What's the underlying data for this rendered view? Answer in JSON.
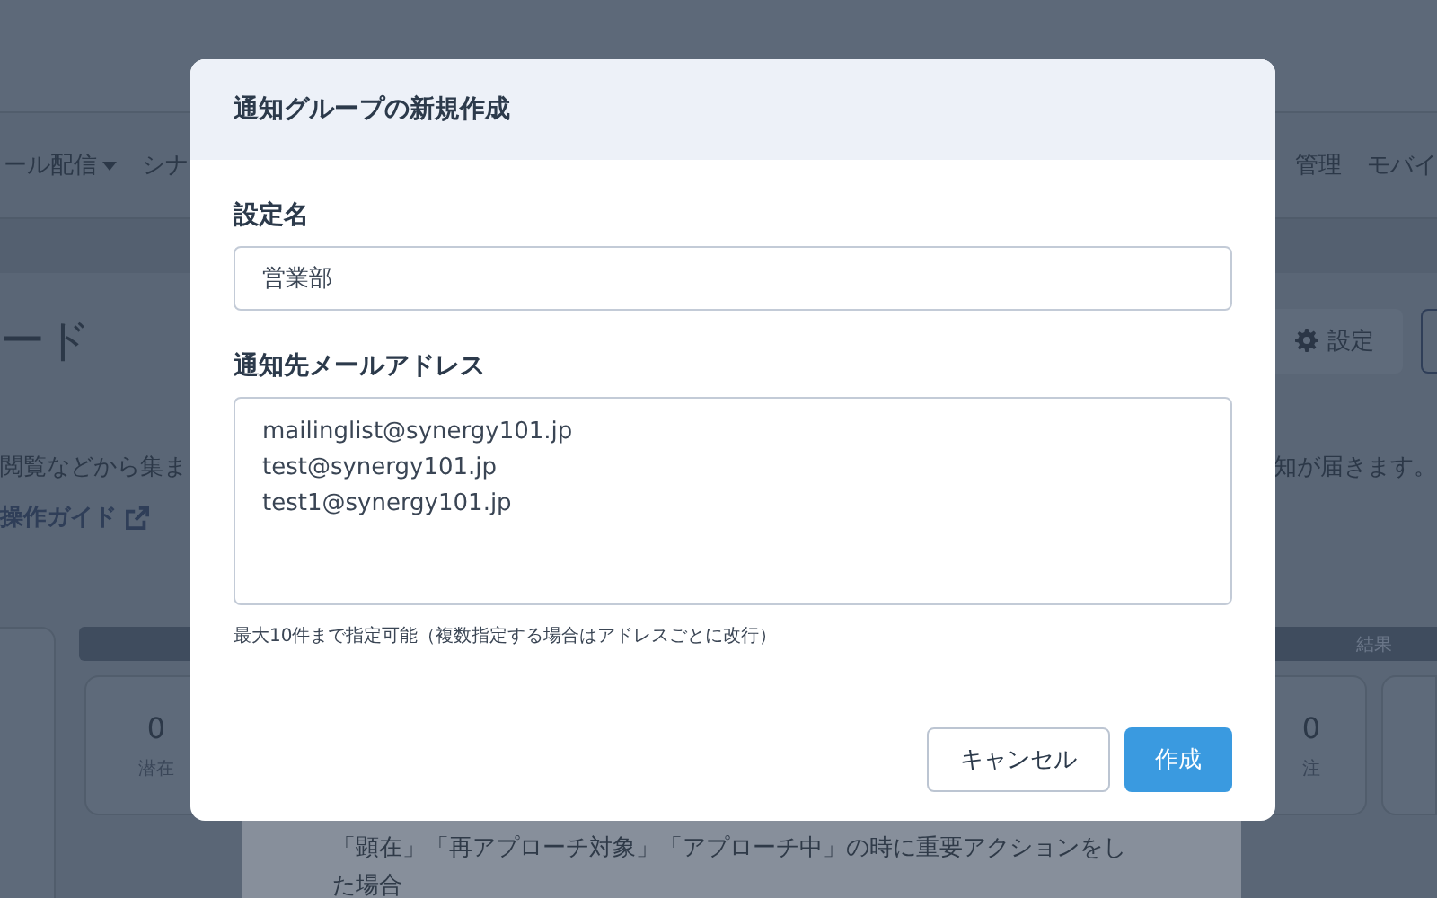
{
  "background": {
    "nav_left": [
      {
        "label": "ール配信",
        "dropdown": true
      },
      {
        "label": "シナ",
        "dropdown": false
      }
    ],
    "nav_right": [
      "管理",
      "モバイ"
    ],
    "page_title": "ード",
    "settings_button": "設定",
    "description_left": "閲覧などから集ま",
    "description_right": "知が届きます。",
    "guide_link": "操作ガイド",
    "section_header": "結果",
    "cards": [
      {
        "value": "0",
        "label": "潜在"
      },
      {
        "value": "0",
        "label": "注"
      }
    ],
    "condition_text": "「顕在」「再アプローチ対象」「アプローチ中」の時に重要アクションをした場合"
  },
  "modal": {
    "title": "通知グループの新規作成",
    "fields": [
      {
        "kind": "input",
        "label": "設定名",
        "value": "営業部"
      },
      {
        "kind": "textarea",
        "label": "通知先メールアドレス",
        "lines": [
          "mailinglist@synergy101.jp",
          "test@synergy101.jp",
          "test1@synergy101.jp"
        ]
      }
    ],
    "hint": "最大10件まで指定可能（複数指定する場合はアドレスごとに改行）",
    "buttons": [
      {
        "kind": "secondary",
        "label": "キャンセル"
      },
      {
        "kind": "primary",
        "label": "作成"
      }
    ]
  }
}
